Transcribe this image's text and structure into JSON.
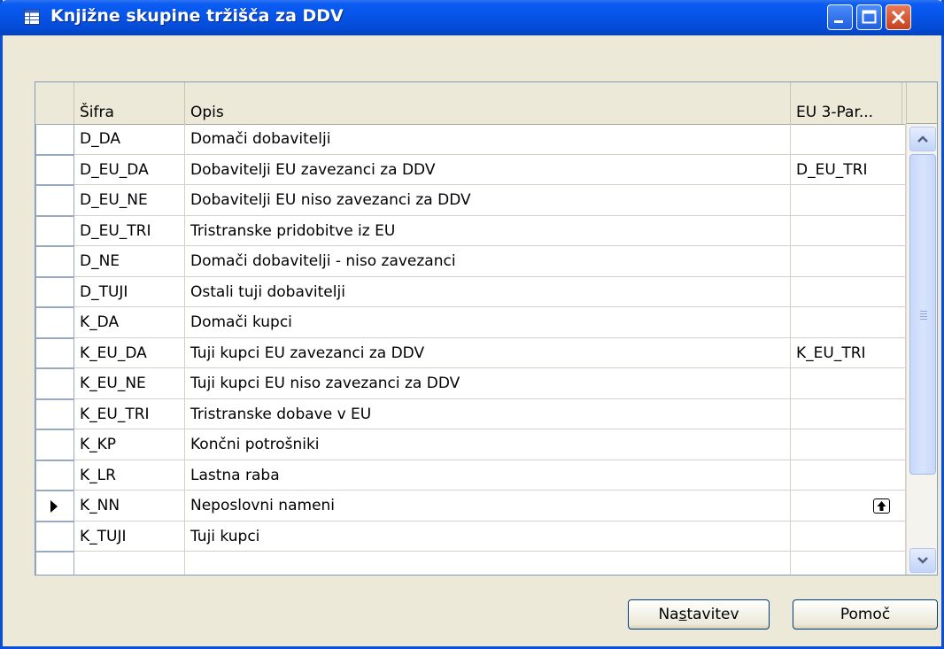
{
  "window": {
    "title": "Knjižne skupine tržišča za DDV",
    "icon": "table-window-icon",
    "controls": [
      "minimize-icon",
      "maximize-icon",
      "close-icon"
    ]
  },
  "grid": {
    "columns": {
      "code": "Šifra",
      "description": "Opis",
      "eu3party": "EU 3-Par..."
    },
    "rows": [
      {
        "code": "D_DA",
        "description": "Domači dobavitelji",
        "eu3party": ""
      },
      {
        "code": "D_EU_DA",
        "description": "Dobavitelji EU zavezanci za DDV",
        "eu3party": "D_EU_TRI"
      },
      {
        "code": "D_EU_NE",
        "description": "Dobavitelji EU niso zavezanci za DDV",
        "eu3party": ""
      },
      {
        "code": "D_EU_TRI",
        "description": "Tristranske pridobitve iz EU",
        "eu3party": ""
      },
      {
        "code": "D_NE",
        "description": "Domači dobavitelji - niso zavezanci",
        "eu3party": ""
      },
      {
        "code": "D_TUJI",
        "description": "Ostali tuji dobavitelji",
        "eu3party": ""
      },
      {
        "code": "K_DA",
        "description": "Domači kupci",
        "eu3party": ""
      },
      {
        "code": "K_EU_DA",
        "description": "Tuji kupci EU zavezanci za DDV",
        "eu3party": "K_EU_TRI"
      },
      {
        "code": "K_EU_NE",
        "description": "Tuji kupci EU niso zavezanci za DDV",
        "eu3party": ""
      },
      {
        "code": "K_EU_TRI",
        "description": "Tristranske dobave v EU",
        "eu3party": ""
      },
      {
        "code": "K_KP",
        "description": "Končni potrošniki",
        "eu3party": ""
      },
      {
        "code": "K_LR",
        "description": "Lastna raba",
        "eu3party": ""
      },
      {
        "code": "K_NN",
        "description": "Neposlovni nameni",
        "eu3party": ""
      },
      {
        "code": "K_TUJI",
        "description": "Tuji kupci",
        "eu3party": ""
      },
      {
        "code": "",
        "description": "",
        "eu3party": ""
      }
    ],
    "selected_row": 12
  },
  "buttons": {
    "setup_pre": "Na",
    "setup_key": "s",
    "setup_post": "tavitev",
    "help": "Pomoč"
  }
}
